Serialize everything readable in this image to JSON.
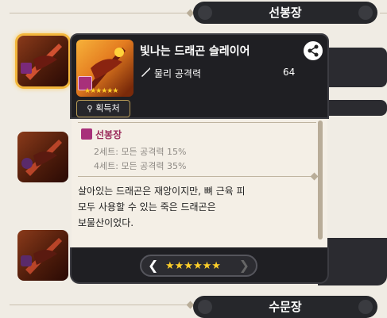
{
  "headers": {
    "top": "선봉장",
    "bottom": "수문장"
  },
  "item": {
    "name": "빛나는 드래곤 슬레이어",
    "stat_label": "물리 공격력",
    "stat_value": "64",
    "stars": "★★★★★★",
    "source_label": "획득처"
  },
  "set": {
    "name": "선봉장",
    "bonus_2": "2세트: 모든 공격력 15%",
    "bonus_4": "4세트: 모든 공격력 35%"
  },
  "description": {
    "line1": "살아있는 드래곤은 재앙이지만, 뼈 근육 피",
    "line2": "모두 사용할 수 있는 죽은 드래곤은",
    "line3": "보물산이었다."
  },
  "star_selector": {
    "stars": "★★★★★★"
  },
  "colors": {
    "accent_gold": "#f3b63b",
    "set_icon": "#a8307a",
    "dark_panel": "#1f1f23"
  }
}
